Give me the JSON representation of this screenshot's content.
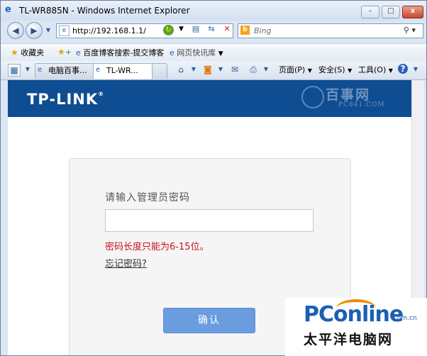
{
  "window": {
    "title": "TL-WR885N - Windows Internet Explorer",
    "minimize_glyph": "–",
    "maximize_glyph": "□",
    "close_glyph": "x"
  },
  "address_bar": {
    "url": "http://192.168.1.1/",
    "search_placeholder": "Bing"
  },
  "favorites_bar": {
    "favorites_label": "收藏夹",
    "items": [
      {
        "label": "百度博客搜索-提交博客"
      },
      {
        "label": "网页快讯库"
      }
    ]
  },
  "tabs": [
    {
      "label": "电脑百事...",
      "active": false
    },
    {
      "label": "TL-WR...",
      "active": true
    }
  ],
  "command_bar": {
    "page_label": "页面(P)",
    "safety_label": "安全(S)",
    "tools_label": "工具(O)"
  },
  "page": {
    "brand": "TP-LINK",
    "brand_mark": "®",
    "watermark_cn": "百事网",
    "watermark_en": "PC841.COM",
    "login": {
      "prompt": "请输入管理员密码",
      "password_value": "",
      "error_message": "密码长度只能为6-15位。",
      "forgot_link": "忘记密码?",
      "confirm_button": "确认"
    }
  },
  "corner_watermark": {
    "brand": "PConline",
    "domain": ".com.cn",
    "chinese": "太平洋电脑网"
  }
}
